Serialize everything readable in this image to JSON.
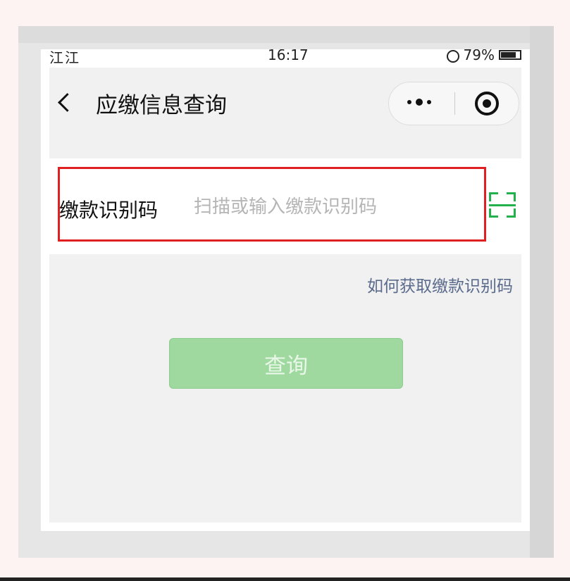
{
  "status_bar": {
    "signal": "江江",
    "time": "16:17",
    "battery": "79%",
    "battery_level": 0.79
  },
  "nav": {
    "title": "应缴信息查询"
  },
  "form": {
    "label": "缴款识别码",
    "placeholder": "扫描或输入缴款识别码",
    "value": ""
  },
  "help_link": "如何获取缴款识别码",
  "query_button": "查询",
  "colors": {
    "accent_green": "#22b14c",
    "button_green": "#9fd99f",
    "highlight_red": "#e02020",
    "link_blue": "#5b6b8c"
  },
  "icons": [
    "back-icon",
    "more-icon",
    "close-icon",
    "scan-icon",
    "alarm-icon",
    "battery-icon"
  ]
}
